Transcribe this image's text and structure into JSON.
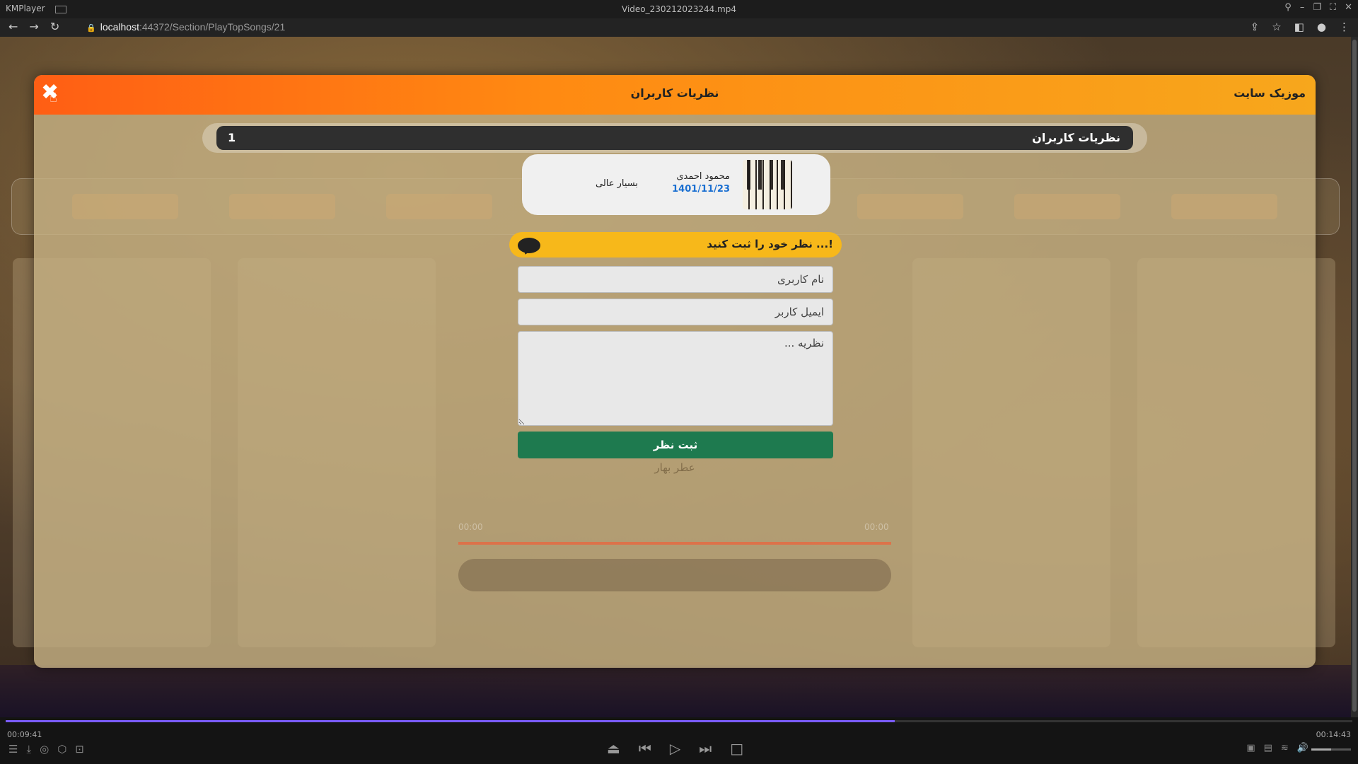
{
  "player": {
    "app_name": "KMPlayer",
    "file_name": "Video_230212023244.mp4",
    "time_elapsed": "00:09:41",
    "time_total": "00:14:43",
    "progress": 0.66,
    "volume": 0.5
  },
  "browser": {
    "url_host": "localhost",
    "url_path": ":44372/Section/PlayTopSongs/21"
  },
  "modal": {
    "title": "نظریات کاربران",
    "site_name": "موزیک سایت",
    "close_label": "✖",
    "comments_header": "نظریات کاربران",
    "comments_count": "1",
    "comment": {
      "author": "محمود احمدی",
      "date": "1401/11/23",
      "text": "بسیار عالی"
    },
    "form": {
      "heading": "نظر خود را ثبت کنید ...!",
      "name_placeholder": "نام کاربری",
      "email_placeholder": "ایمیل کاربر",
      "comment_placeholder": "نظریه ...",
      "submit_label": "ثبت نظر"
    }
  },
  "background": {
    "faded_text": "عطر بهار",
    "time_start": "00:00",
    "time_end": "00:00"
  },
  "colors": {
    "header_start": "#ff5e14",
    "header_end": "#f7a71c",
    "submit": "#1e7a4f",
    "date": "#1a6fd1",
    "seek": "#7b5cff"
  }
}
